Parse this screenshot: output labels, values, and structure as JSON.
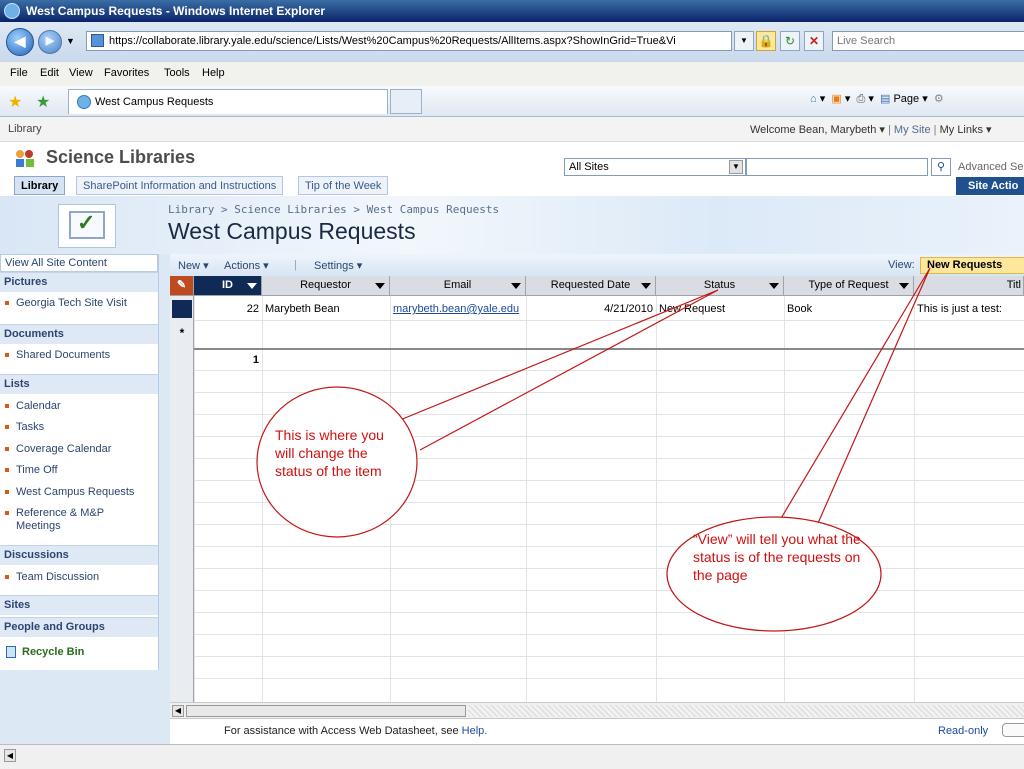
{
  "browser": {
    "window_title": "West Campus Requests - Windows Internet Explorer",
    "url": "https://collaborate.library.yale.edu/science/Lists/West%20Campus%20Requests/AllItems.aspx?ShowInGrid=True&Vi",
    "search_placeholder": "Live Search",
    "menu": [
      "File",
      "Edit",
      "View",
      "Favorites",
      "Tools",
      "Help"
    ],
    "tab_title": "West Campus Requests",
    "page_menu": "Page"
  },
  "sharepoint": {
    "top_left": "Library",
    "welcome": "Welcome Bean, Marybeth",
    "my_site": "My Site",
    "my_links": "My Links",
    "site_title": "Science Libraries",
    "search_scope": "All Sites",
    "advanced_search": "Advanced Se",
    "top_nav": [
      "Library",
      "SharePoint Information and Instructions",
      "Tip of the Week"
    ],
    "site_actions": "Site Actio",
    "breadcrumb": "Library > Science Libraries > West Campus Requests",
    "page_title": "West Campus Requests"
  },
  "left_nav": {
    "view_all": "View All Site Content",
    "pictures": "Pictures",
    "pictures_items": [
      "Georgia Tech Site Visit"
    ],
    "documents": "Documents",
    "documents_items": [
      "Shared Documents"
    ],
    "lists": "Lists",
    "lists_items": [
      "Calendar",
      "Tasks",
      "Coverage Calendar",
      "Time Off",
      "West Campus Requests",
      "Reference & M&P Meetings"
    ],
    "discussions": "Discussions",
    "discussions_items": [
      "Team Discussion"
    ],
    "sites": "Sites",
    "people": "People and Groups",
    "recycle": "Recycle Bin"
  },
  "toolbar": {
    "new": "New",
    "actions": "Actions",
    "settings": "Settings",
    "view_label": "View:",
    "view_value": "New Requests"
  },
  "grid": {
    "columns": [
      "ID",
      "Requestor",
      "Email",
      "Requested Date",
      "Status",
      "Type of Request",
      "Titl"
    ],
    "row": {
      "id": "22",
      "requestor": "Marybeth Bean",
      "email": "marybeth.bean@yale.edu",
      "date": "4/21/2010",
      "status": "New Request",
      "type": "Book",
      "title": "This is just a test:"
    },
    "new_row_marker": "*",
    "total": "1"
  },
  "footer": {
    "assist": "For assistance with Access Web Datasheet, see ",
    "help": "Help.",
    "readonly": "Read-only"
  },
  "callouts": {
    "status_note": "This is where you will change the status of the item",
    "view_note": "“View” will tell you what the status is of the requests on the page"
  },
  "colors": {
    "callout": "#d01010",
    "id_header": "#0f2a55",
    "view_highlight": "#fde79a"
  }
}
